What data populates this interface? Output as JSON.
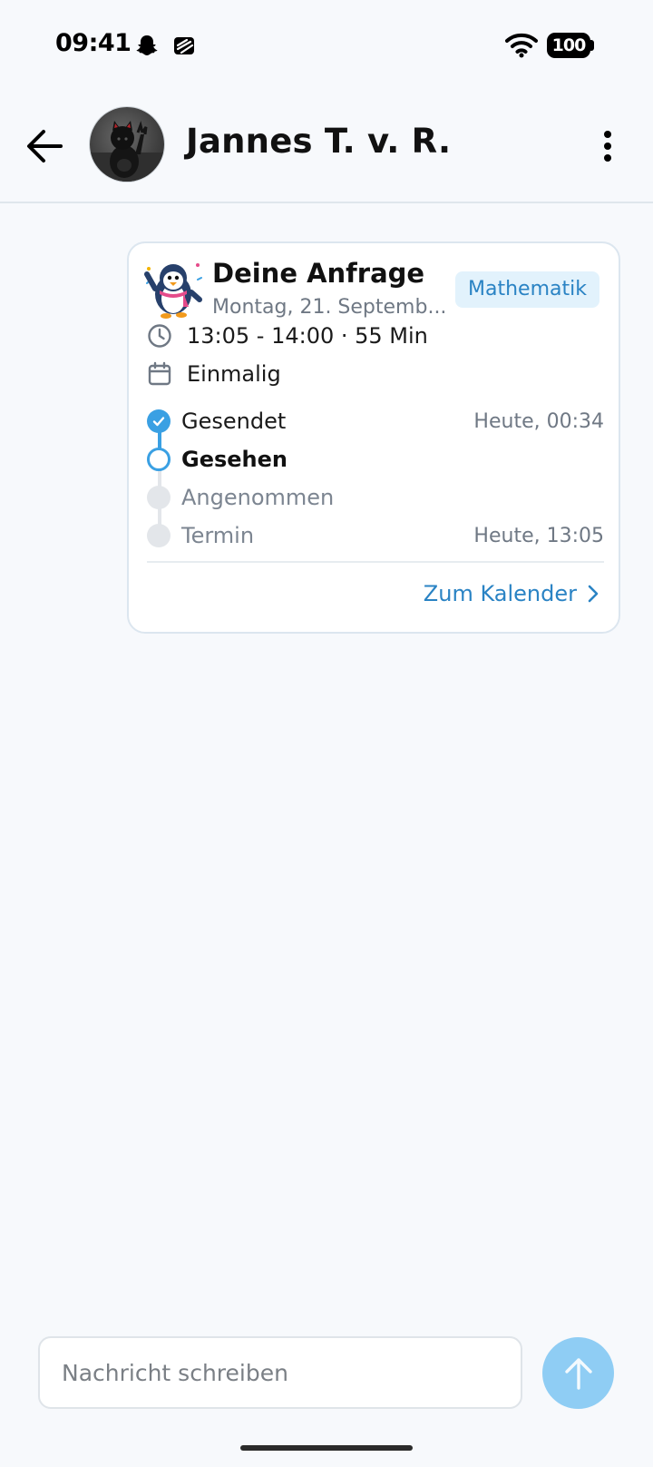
{
  "status_bar": {
    "time": "09:41",
    "battery": "100",
    "icons": [
      "snapchat-icon",
      "app-notification-icon",
      "wifi-icon",
      "battery-icon"
    ]
  },
  "header": {
    "contact_name": "Jannes T. v. R.",
    "icons": [
      "back-arrow-icon",
      "more-vertical-icon"
    ]
  },
  "request_card": {
    "title": "Deine Anfrage",
    "date": "Montag, 21. Septemb...",
    "subject": "Mathematik",
    "time_range": "13:05 - 14:00 · 55 Min",
    "recurrence": "Einmalig",
    "steps": [
      {
        "label": "Gesendet",
        "time": "Heute, 00:34",
        "state": "done"
      },
      {
        "label": "Gesehen",
        "time": "",
        "state": "current"
      },
      {
        "label": "Angenommen",
        "time": "",
        "state": "pending"
      },
      {
        "label": "Termin",
        "time": "Heute, 13:05",
        "state": "pending"
      }
    ],
    "calendar_link": "Zum Kalender"
  },
  "composer": {
    "placeholder": "Nachricht schreiben",
    "value": ""
  },
  "colors": {
    "accent": "#3aa0e3",
    "link": "#2a83c4",
    "badge_bg": "#e2f2fc",
    "send_button": "#8fcdf4",
    "background": "#f7f9fc"
  }
}
